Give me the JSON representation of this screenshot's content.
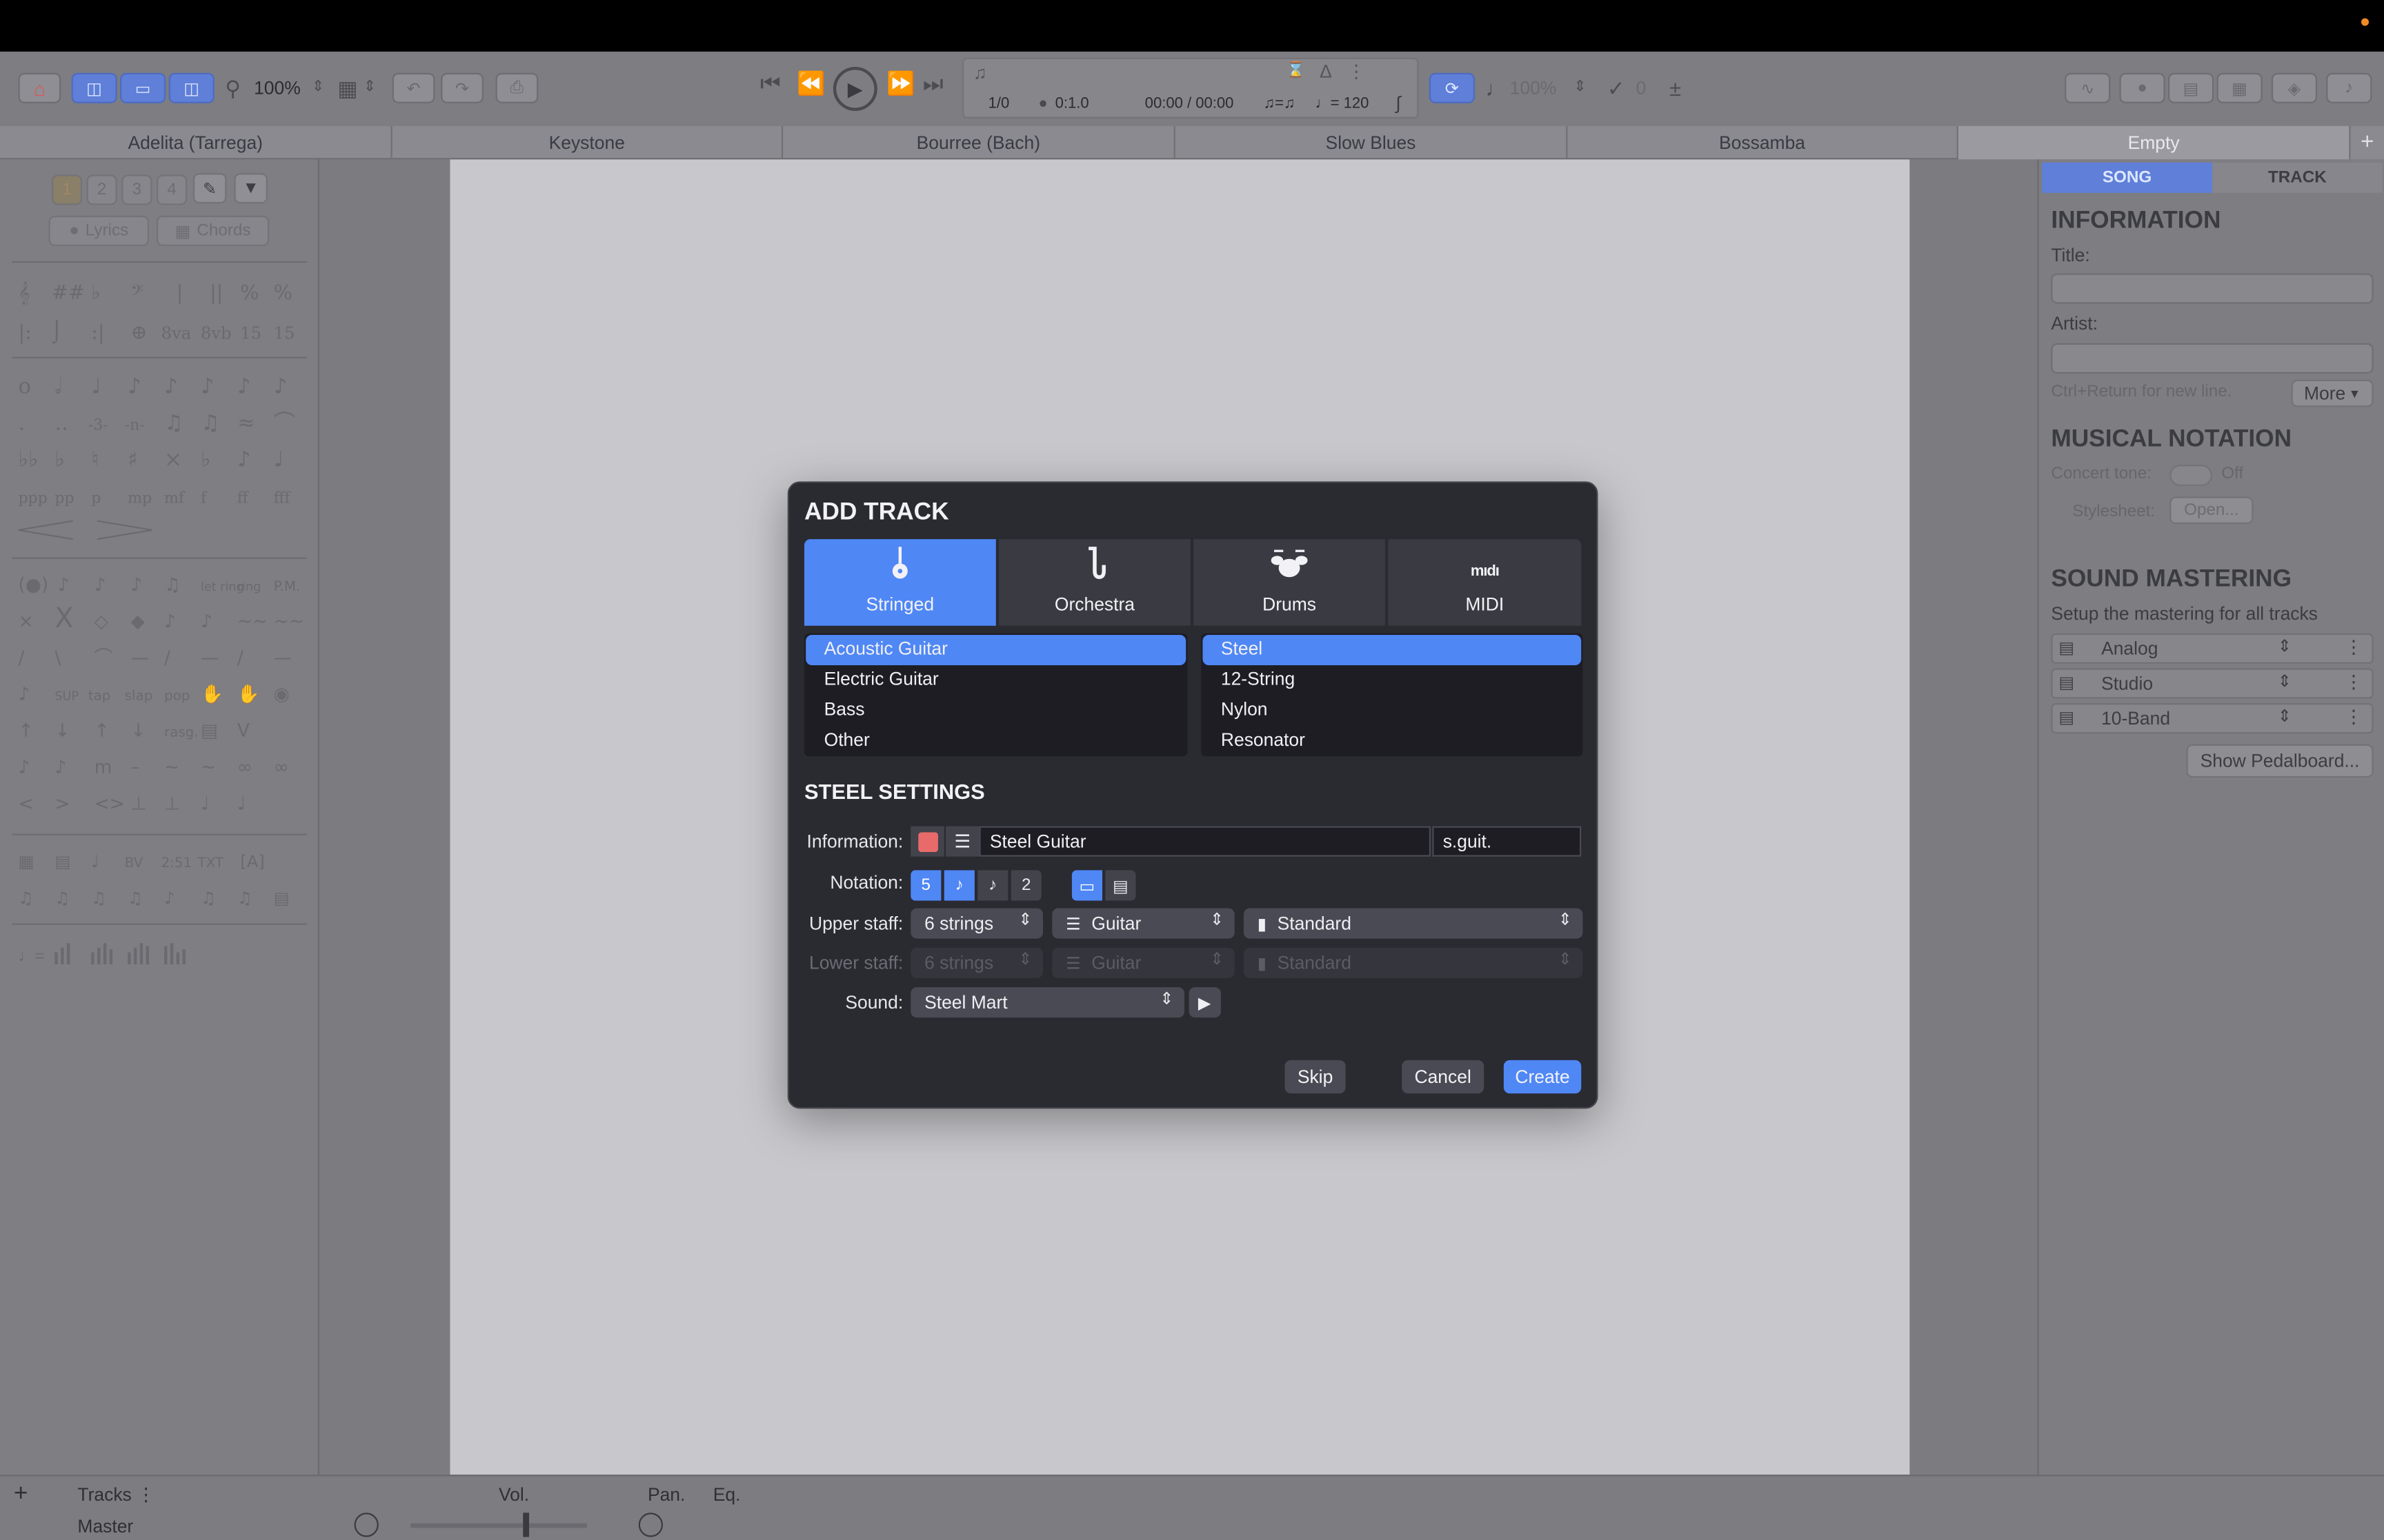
{
  "toolbar": {
    "zoom": "100%",
    "lcd": {
      "bar": "1/0",
      "position": "0:1.0",
      "time": "00:00 / 00:00",
      "tempo": "♩= 120",
      "triplet": "♫=♫"
    },
    "volume": "100%",
    "capo": "0"
  },
  "tabs": [
    "Adelita (Tarrega)",
    "Keystone",
    "Bourree (Bach)",
    "Slow Blues",
    "Bossamba",
    "Empty"
  ],
  "active_tab_index": 5,
  "left_panel": {
    "voices": [
      "1",
      "2",
      "3",
      "4"
    ],
    "lyrics_label": "Lyrics",
    "chords_label": "Chords"
  },
  "right_panel": {
    "tabs": [
      "SONG",
      "TRACK"
    ],
    "information_heading": "INFORMATION",
    "title_label": "Title:",
    "artist_label": "Artist:",
    "hint": "Ctrl+Return for new line.",
    "more_label": "More",
    "notation_heading": "MUSICAL NOTATION",
    "concert_tone_label": "Concert tone:",
    "concert_tone_value": "Off",
    "stylesheet_label": "Stylesheet:",
    "stylesheet_button": "Open...",
    "mastering_heading": "SOUND MASTERING",
    "mastering_desc": "Setup the mastering for all tracks",
    "mastering_presets": [
      "Analog",
      "Studio",
      "10-Band"
    ],
    "pedalboard_label": "Show Pedalboard..."
  },
  "bottom_bar": {
    "tracks_label": "Tracks",
    "master_label": "Master",
    "vol_label": "Vol.",
    "pan_label": "Pan.",
    "eq_label": "Eq."
  },
  "dialog": {
    "title": "ADD TRACK",
    "categories": [
      {
        "label": "Stringed",
        "icon": "guitar-icon"
      },
      {
        "label": "Orchestra",
        "icon": "saxophone-icon"
      },
      {
        "label": "Drums",
        "icon": "drum-kit-icon"
      },
      {
        "label": "MIDI",
        "icon": "midi-icon"
      }
    ],
    "active_category": 0,
    "instruments": [
      "Acoustic Guitar",
      "Electric Guitar",
      "Bass",
      "Other"
    ],
    "selected_instrument": 0,
    "variants": [
      "Steel",
      "12-String",
      "Nylon",
      "Resonator"
    ],
    "selected_variant": 0,
    "settings_heading": "STEEL SETTINGS",
    "information_label": "Information:",
    "track_color": "#e86a6a",
    "track_name": "Steel Guitar",
    "track_short_name": "s.guit.",
    "notation_label": "Notation:",
    "notation_buttons": [
      "5",
      "♪",
      "♪",
      "2"
    ],
    "upper_staff_label": "Upper staff:",
    "upper_staff": {
      "strings": "6 strings",
      "instrument": "Guitar",
      "tuning": "Standard"
    },
    "lower_staff_label": "Lower staff:",
    "lower_staff": {
      "strings": "6 strings",
      "instrument": "Guitar",
      "tuning": "Standard"
    },
    "sound_label": "Sound:",
    "sound_value": "Steel Mart",
    "skip_label": "Skip",
    "cancel_label": "Cancel",
    "create_label": "Create"
  },
  "colors": {
    "accent": "#4f87f5",
    "dialog_bg": "#2a2a31",
    "page_bg": "#c8c8cc"
  }
}
